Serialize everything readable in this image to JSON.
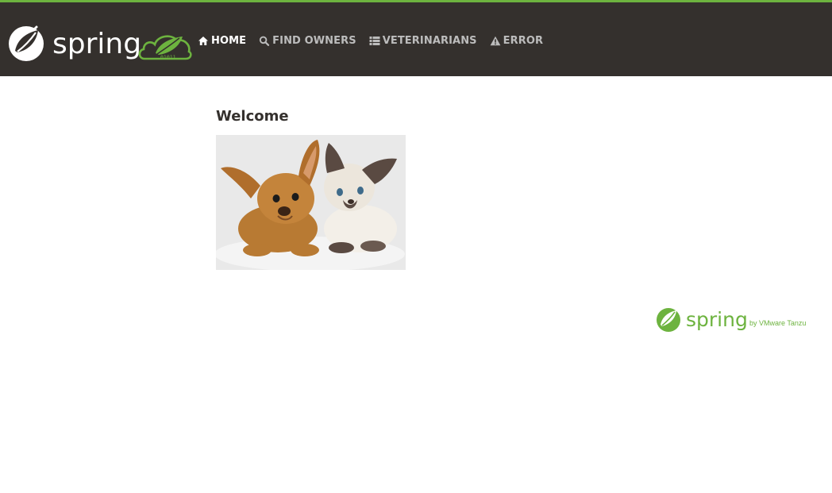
{
  "app": {
    "brand_wordmark": "spring",
    "brand_badge_digits": "01011"
  },
  "nav": {
    "items": [
      {
        "label": "HOME",
        "icon": "home-icon",
        "active": true
      },
      {
        "label": "FIND OWNERS",
        "icon": "search-icon",
        "active": false
      },
      {
        "label": "VETERINARIANS",
        "icon": "list-icon",
        "active": false
      },
      {
        "label": "ERROR",
        "icon": "warning-icon",
        "active": false
      }
    ]
  },
  "main": {
    "title": "Welcome",
    "image_alt": "pets"
  },
  "footer": {
    "wordmark": "spring",
    "tagline": "by VMware Tanzu"
  },
  "colors": {
    "navbar_bg": "#34302d",
    "accent_green": "#6db33f",
    "nav_inactive": "#bcbcbc",
    "nav_active": "#ffffff",
    "title_text": "#34302d"
  }
}
